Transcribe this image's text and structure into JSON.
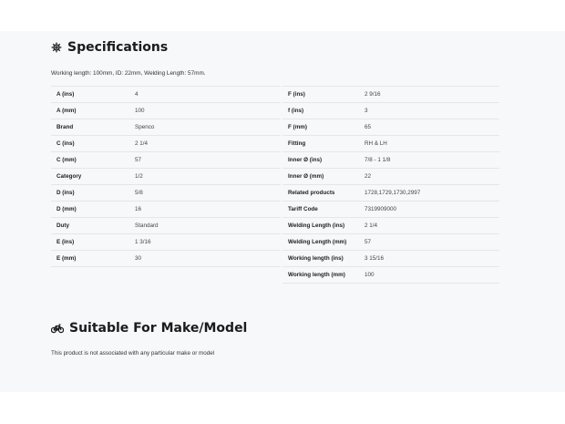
{
  "specs": {
    "title": "Specifications",
    "intro": "Working length: 100mm, ID: 22mm, Welding Length: 57mm.",
    "left": [
      {
        "label": "A (ins)",
        "value": "4"
      },
      {
        "label": "A (mm)",
        "value": "100"
      },
      {
        "label": "Brand",
        "value": "Spenco"
      },
      {
        "label": "C (ins)",
        "value": "2 1/4"
      },
      {
        "label": "C (mm)",
        "value": "57"
      },
      {
        "label": "Category",
        "value": "1/2"
      },
      {
        "label": "D (ins)",
        "value": "5/8"
      },
      {
        "label": "D (mm)",
        "value": "16"
      },
      {
        "label": "Duty",
        "value": "Standard"
      },
      {
        "label": "E (ins)",
        "value": "1 3/16"
      },
      {
        "label": "E (mm)",
        "value": "30"
      }
    ],
    "right": [
      {
        "label": "F (ins)",
        "value": "2 9/16"
      },
      {
        "label": "f (ins)",
        "value": "3"
      },
      {
        "label": "F (mm)",
        "value": "65"
      },
      {
        "label": "Fitting",
        "value": "RH & LH"
      },
      {
        "label": "Inner Ø (ins)",
        "value": "7/8 - 1 1/8"
      },
      {
        "label": "Inner Ø (mm)",
        "value": "22"
      },
      {
        "label": "Related products",
        "value": "1728,1729,1730,2997"
      },
      {
        "label": "Tariff Code",
        "value": "7319909000"
      },
      {
        "label": "Welding Length (ins)",
        "value": "2 1/4"
      },
      {
        "label": "Welding Length (mm)",
        "value": "57"
      },
      {
        "label": "Working length (ins)",
        "value": "3 15/16"
      },
      {
        "label": "Working length (mm)",
        "value": "100"
      }
    ]
  },
  "suitable": {
    "title": "Suitable For Make/Model",
    "note": "This product is not associated with any particular make or model"
  },
  "icons": {
    "specs": "gear-icon",
    "suitable": "bicycle-icon"
  }
}
